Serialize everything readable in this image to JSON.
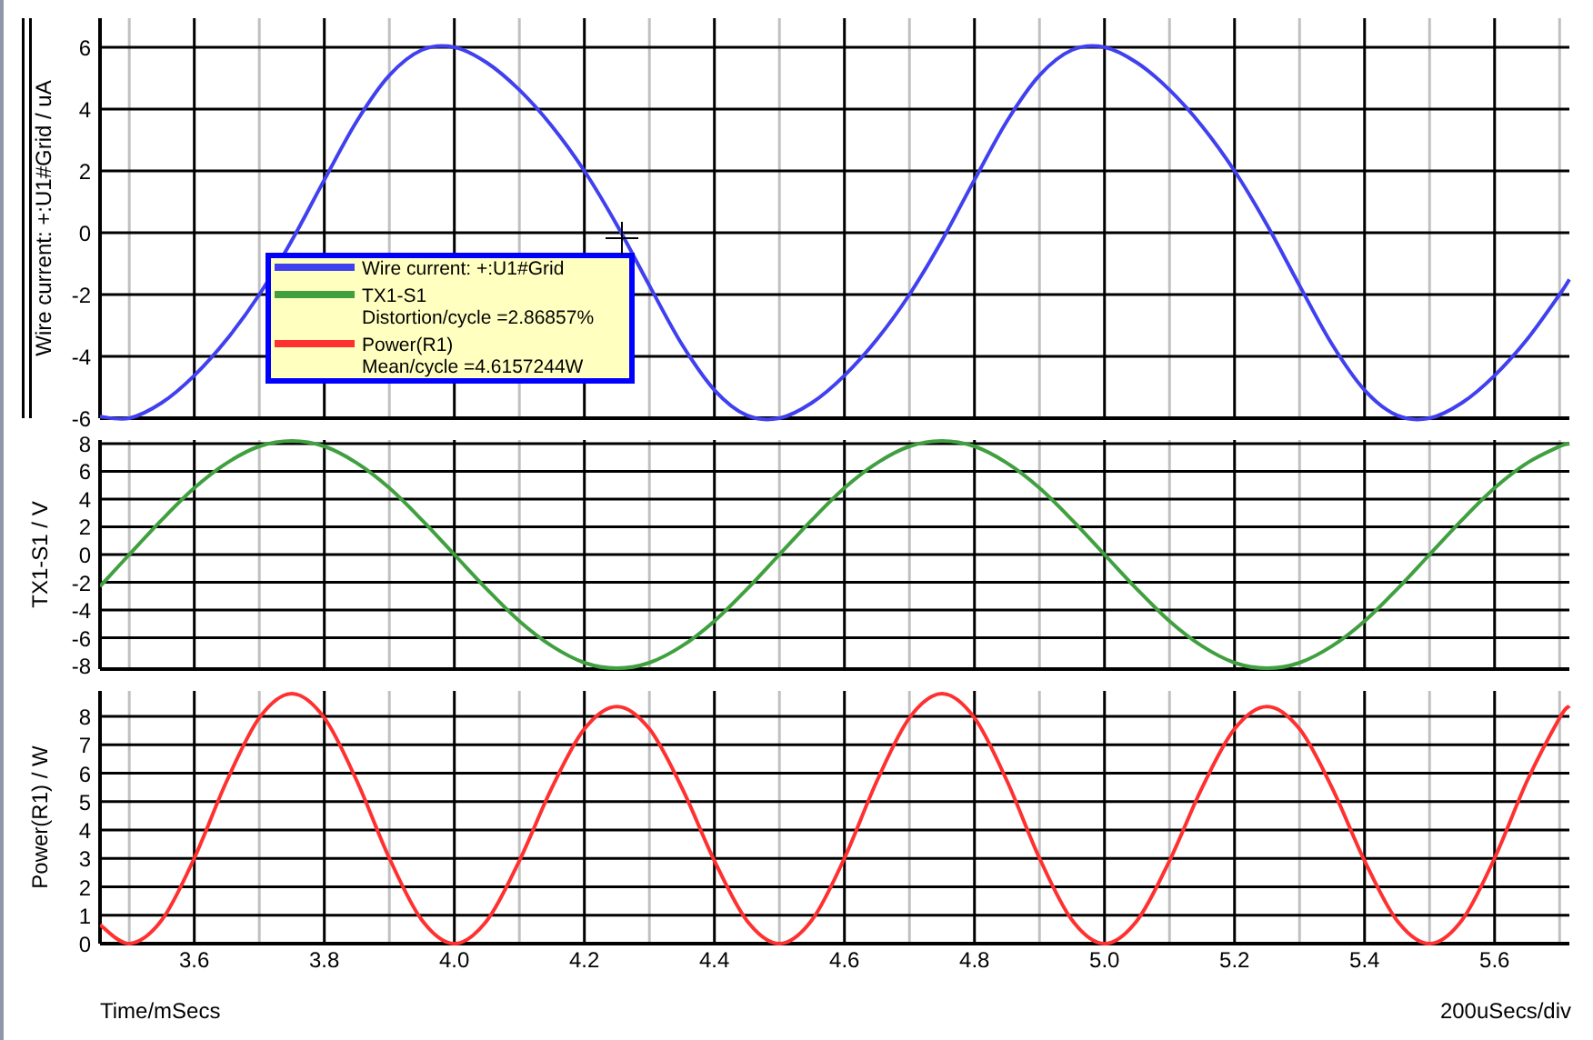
{
  "panels": [
    {
      "chart_data": {
        "type": "line",
        "ylabel": "Wire current: +:U1#Grid / uA",
        "grid": true,
        "x": [
          3.455,
          3.5,
          3.55,
          3.6,
          3.65,
          3.7,
          3.75,
          3.8,
          3.85,
          3.9,
          3.95,
          4.0,
          4.05,
          4.1,
          4.15,
          4.2,
          4.25,
          4.3,
          4.35,
          4.4,
          4.45,
          4.5,
          4.55,
          4.6,
          4.65,
          4.7,
          4.75,
          4.8,
          4.85,
          4.9,
          4.95,
          5.0,
          5.05,
          5.1,
          5.15,
          5.2,
          5.25,
          5.3,
          5.35,
          5.4,
          5.45,
          5.5,
          5.55,
          5.6,
          5.65,
          5.7,
          5.715
        ],
        "xlim": [
          3.455,
          5.715
        ],
        "ylim": [
          -6,
          6.94
        ],
        "yticks": [
          -6,
          -4,
          -2,
          0,
          2,
          4,
          6
        ],
        "series": [
          {
            "name": "Wire current: +:U1#Grid",
            "color": "#4040f0",
            "values": [
              -5.95,
              -6,
              -5.5,
              -4.62,
              -3.45,
              -2.0,
              -0.25,
              1.71,
              3.61,
              5.09,
              5.91,
              6,
              5.5,
              4.62,
              3.45,
              2.0,
              0.25,
              -1.71,
              -3.61,
              -5.09,
              -5.91,
              -6,
              -5.5,
              -4.62,
              -3.45,
              -2.0,
              -0.25,
              1.71,
              3.61,
              5.09,
              5.91,
              6,
              5.5,
              4.62,
              3.45,
              2.0,
              0.25,
              -1.71,
              -3.61,
              -5.09,
              -5.91,
              -6,
              -5.5,
              -4.62,
              -3.45,
              -2.0,
              -1.51
            ]
          }
        ]
      }
    },
    {
      "chart_data": {
        "type": "line",
        "ylabel": "TX1-S1 / V",
        "grid": true,
        "x": [
          3.455,
          3.5,
          3.55,
          3.6,
          3.65,
          3.7,
          3.75,
          3.8,
          3.85,
          3.9,
          3.95,
          4.0,
          4.05,
          4.1,
          4.15,
          4.2,
          4.25,
          4.3,
          4.35,
          4.4,
          4.45,
          4.5,
          4.55,
          4.6,
          4.65,
          4.7,
          4.75,
          4.8,
          4.85,
          4.9,
          4.95,
          5.0,
          5.05,
          5.1,
          5.15,
          5.2,
          5.25,
          5.3,
          5.35,
          5.4,
          5.45,
          5.5,
          5.55,
          5.6,
          5.65,
          5.7,
          5.715
        ],
        "xlim": [
          3.455,
          5.715
        ],
        "ylim": [
          -8.26,
          8.26
        ],
        "yticks": [
          -8,
          -6,
          -4,
          -2,
          0,
          2,
          4,
          6,
          8
        ],
        "series": [
          {
            "name": "TX1-S1",
            "color": "#40a040",
            "values": [
              -2.3,
              0,
              2.5,
              4.8,
              6.6,
              7.8,
              8.2,
              7.8,
              6.6,
              4.8,
              2.5,
              0,
              -2.5,
              -4.8,
              -6.6,
              -7.8,
              -8.2,
              -7.8,
              -6.6,
              -4.8,
              -2.5,
              0,
              2.5,
              4.8,
              6.6,
              7.8,
              8.2,
              7.8,
              6.6,
              4.8,
              2.5,
              0,
              -2.5,
              -4.8,
              -6.6,
              -7.8,
              -8.2,
              -7.8,
              -6.6,
              -4.8,
              -2.5,
              0,
              2.5,
              4.8,
              6.6,
              7.8,
              8.0
            ]
          }
        ]
      },
      "legend_note": "Distortion/cycle =2.86857%"
    },
    {
      "chart_data": {
        "type": "line",
        "xlabel": "Time/mSecs",
        "ylabel": "Power(R1) / W",
        "grid": true,
        "x": [
          3.455,
          3.5,
          3.55,
          3.6,
          3.65,
          3.7,
          3.75,
          3.8,
          3.85,
          3.9,
          3.95,
          4.0,
          4.05,
          4.1,
          4.15,
          4.2,
          4.25,
          4.3,
          4.35,
          4.4,
          4.45,
          4.5,
          4.55,
          4.6,
          4.65,
          4.7,
          4.75,
          4.8,
          4.85,
          4.9,
          4.95,
          5.0,
          5.05,
          5.1,
          5.15,
          5.2,
          5.25,
          5.3,
          5.35,
          5.4,
          5.45,
          5.5,
          5.55,
          5.6,
          5.65,
          5.7,
          5.715
        ],
        "xlim": [
          3.455,
          5.715
        ],
        "ylim": [
          0,
          8.9
        ],
        "xticks": [
          {
            "value": 3.6,
            "label": "3.6"
          },
          {
            "value": 3.8,
            "label": "3.8"
          },
          {
            "value": 4.0,
            "label": "4.0"
          },
          {
            "value": 4.2,
            "label": "4.2"
          },
          {
            "value": 4.4,
            "label": "4.4"
          },
          {
            "value": 4.6,
            "label": "4.6"
          },
          {
            "value": 4.8,
            "label": "4.8"
          },
          {
            "value": 5.0,
            "label": "5.0"
          },
          {
            "value": 5.2,
            "label": "5.2"
          },
          {
            "value": 5.4,
            "label": "5.4"
          },
          {
            "value": 5.6,
            "label": "5.6"
          }
        ],
        "yticks": [
          0,
          1,
          2,
          3,
          4,
          5,
          6,
          7,
          8
        ],
        "series": [
          {
            "name": "Power(R1)",
            "color": "#ff3030",
            "values": [
              0.66,
              0,
              0.83,
              3.01,
              5.73,
              7.95,
              8.8,
              7.95,
              5.73,
              3.01,
              0.83,
              0,
              0.81,
              2.92,
              5.49,
              7.56,
              8.35,
              7.56,
              5.49,
              2.92,
              0.81,
              0,
              0.83,
              3.01,
              5.73,
              7.95,
              8.8,
              7.95,
              5.73,
              3.01,
              0.83,
              0,
              0.81,
              2.92,
              5.49,
              7.56,
              8.35,
              7.56,
              5.49,
              2.92,
              0.81,
              0,
              0.83,
              3.01,
              5.73,
              7.95,
              8.37
            ]
          }
        ]
      },
      "legend_note": "Mean/cycle =4.6157244W"
    }
  ],
  "scale_note": "200uSecs/div"
}
